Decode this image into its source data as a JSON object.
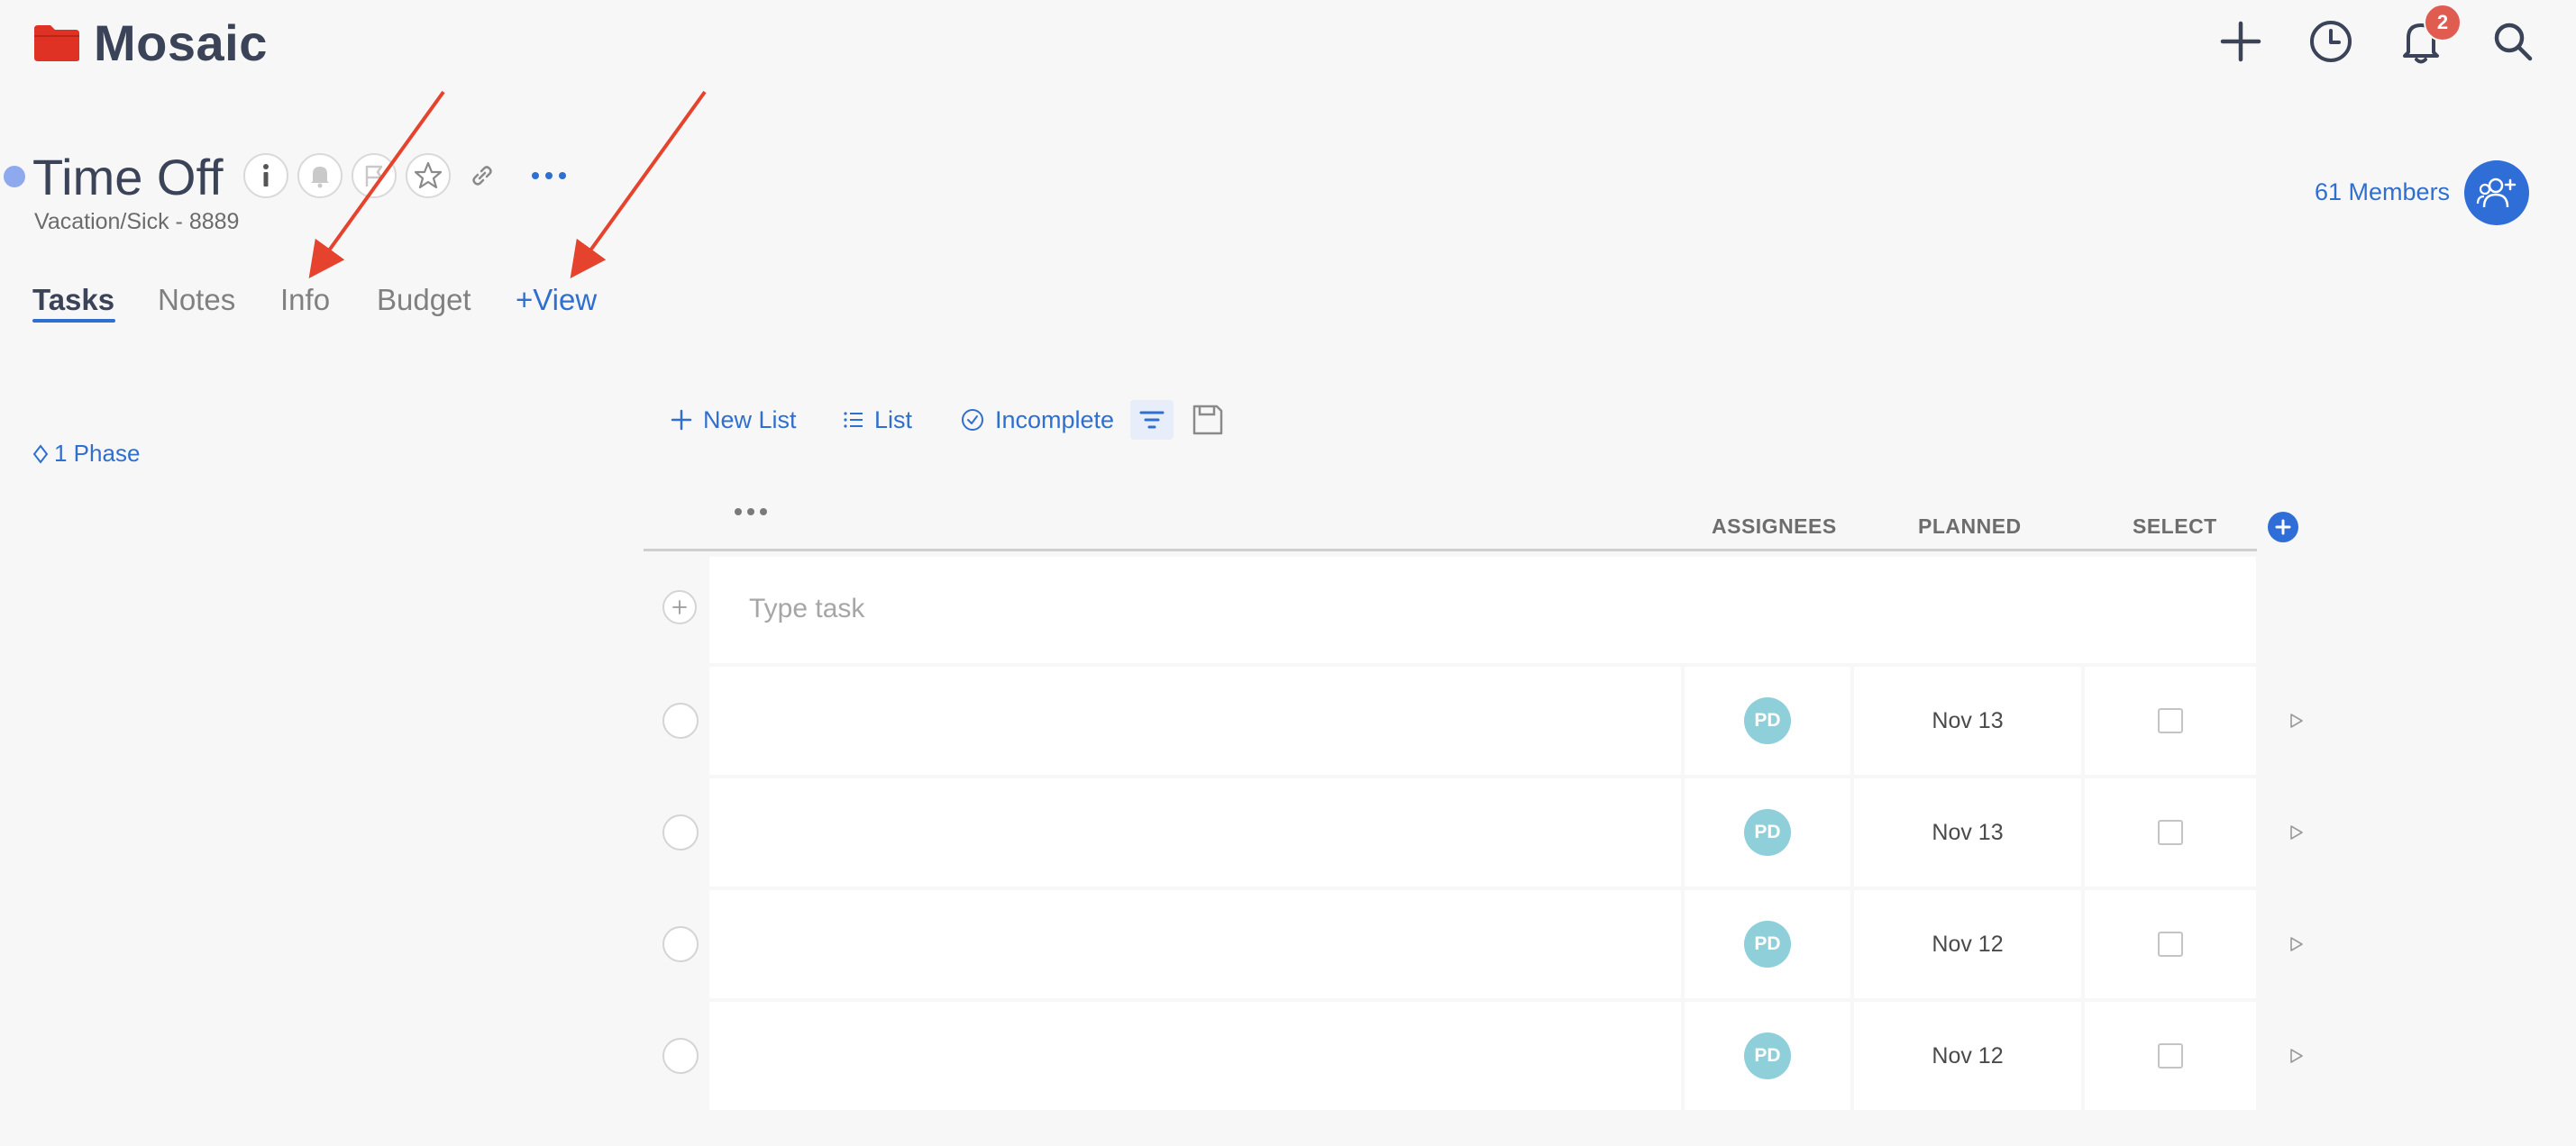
{
  "app": {
    "name": "Mosaic",
    "colors": {
      "brand": "#e03224",
      "accent": "#2f6fcf",
      "badge": "#e05c50",
      "avatar": "#8ecfd9",
      "annotation_arrow": "#e5432e"
    }
  },
  "header": {
    "icons": [
      "plus-icon",
      "clock-icon",
      "bell-icon",
      "search-icon"
    ],
    "notification_count": "2"
  },
  "project": {
    "title": "Time Off",
    "subtitle": "Vacation/Sick - 8889",
    "members_label": "61 Members",
    "title_icons": [
      "info-icon",
      "bell-icon",
      "flag-icon",
      "star-icon",
      "link-icon",
      "more-icon"
    ]
  },
  "tabs": [
    {
      "label": "Tasks",
      "active": true
    },
    {
      "label": "Notes"
    },
    {
      "label": "Info"
    },
    {
      "label": "Budget"
    },
    {
      "label": "+View"
    }
  ],
  "sidebar": {
    "phase_label": "1 Phase"
  },
  "toolbar": {
    "new_list": "New List",
    "list": "List",
    "incomplete": "Incomplete"
  },
  "table": {
    "columns": [
      "ASSIGNEES",
      "PLANNED",
      "SELECT"
    ],
    "add_task_placeholder": "Type task",
    "rows": [
      {
        "assignee": "PD",
        "planned": "Nov 13"
      },
      {
        "assignee": "PD",
        "planned": "Nov 13"
      },
      {
        "assignee": "PD",
        "planned": "Nov 12"
      },
      {
        "assignee": "PD",
        "planned": "Nov 12"
      }
    ]
  }
}
